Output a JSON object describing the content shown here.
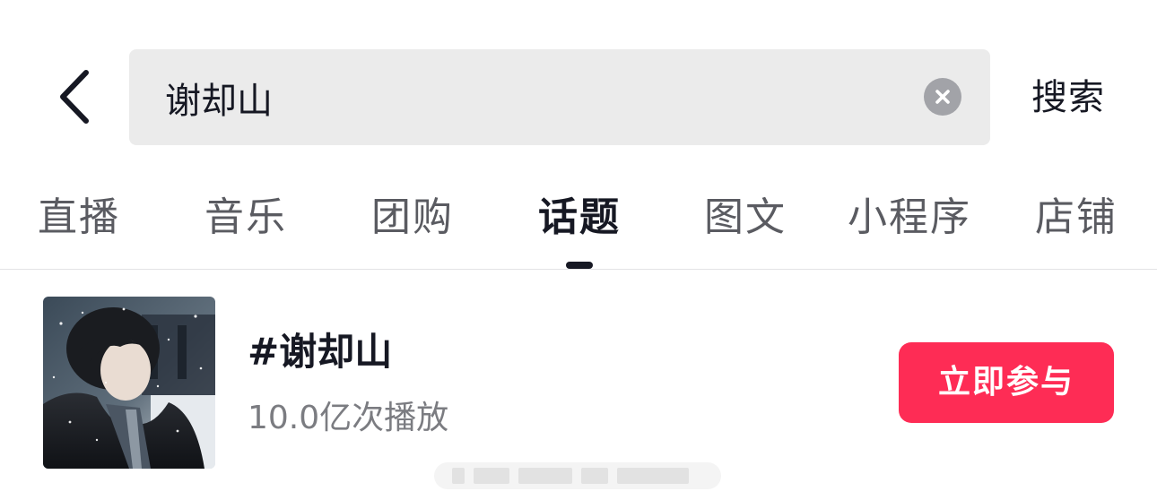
{
  "search": {
    "query": "谢却山",
    "action_label": "搜索"
  },
  "tabs": [
    {
      "label": "直播",
      "active": false
    },
    {
      "label": "音乐",
      "active": false
    },
    {
      "label": "团购",
      "active": false
    },
    {
      "label": "话题",
      "active": true
    },
    {
      "label": "图文",
      "active": false
    },
    {
      "label": "小程序",
      "active": false
    },
    {
      "label": "店铺",
      "active": false
    }
  ],
  "topic": {
    "title": "#谢却山",
    "plays": "10.0亿次播放",
    "join_label": "立即参与"
  },
  "icons": {
    "back": "chevron-left-icon",
    "clear": "clear-circle-icon"
  },
  "colors": {
    "accent": "#fe2c55",
    "text_primary": "#161823",
    "text_secondary": "#7b7c81",
    "search_bg": "#ebebeb"
  }
}
